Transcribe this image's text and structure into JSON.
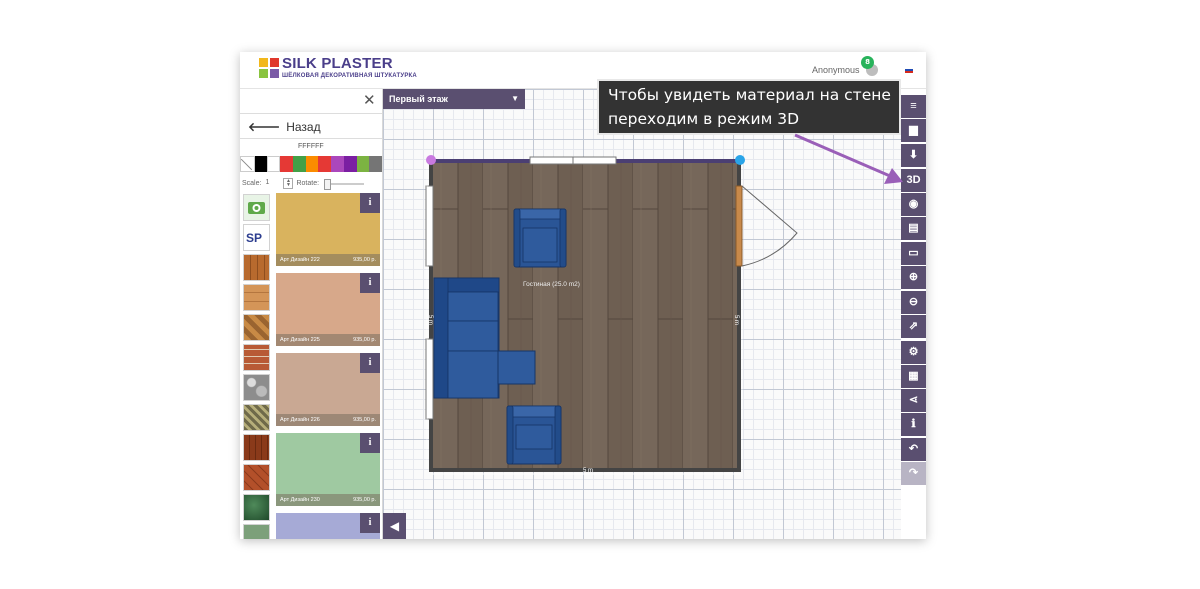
{
  "app": {
    "brand": "SILK PLASTER",
    "tagline": "ШЁЛКОВАЯ ДЕКОРАТИВНАЯ ШТУКАТУРКА",
    "user": {
      "name": "Anonymous",
      "badge": "8"
    },
    "flag_colors": [
      "#ffffff",
      "#1f4bb4",
      "#d52b1e"
    ]
  },
  "sidebar": {
    "back_label": "Назад",
    "color_hex": "FFFFFF",
    "palette": [
      "#000000",
      "#ffffff",
      "#e53935",
      "#43a047",
      "#fb8c00",
      "#e53935",
      "#ab47bc",
      "#7b1fa2",
      "#7cb342",
      "#757575"
    ],
    "scale_label": "Scale:",
    "scale_value": "1",
    "rotate_label": "Rotate:",
    "thumbnails": [
      "camera-upload",
      "sp-logo",
      "wood-planks",
      "wood-light",
      "parquet-diamond",
      "brick",
      "stones",
      "ornament-tile",
      "wood-dark",
      "terracotta",
      "green-marble",
      "partial"
    ],
    "materials": [
      {
        "name": "Арт Дизайн 222",
        "price": "935,00 р.",
        "color": "#d9b35e"
      },
      {
        "name": "Арт Дизайн 225",
        "price": "935,00 р.",
        "color": "#d7a88a"
      },
      {
        "name": "Арт Дизайн 226",
        "price": "935,00 р.",
        "color": "#c9a893"
      },
      {
        "name": "Арт Дизайн 230",
        "price": "935,00 р.",
        "color": "#9fc9a1"
      },
      {
        "name": "",
        "price": "",
        "color": "#a6aad6"
      }
    ]
  },
  "canvas": {
    "floor_selector": "Первый этаж",
    "room_label": "Гостиная (25.0 m2)",
    "dim_bottom": "5 m",
    "dim_left": "5 m",
    "dim_right": "5 m"
  },
  "toolbar": {
    "items": [
      {
        "id": "menu",
        "label": "≡"
      },
      {
        "id": "open",
        "label": "▆"
      },
      {
        "id": "download",
        "label": "⬇"
      },
      {
        "id": "3d",
        "label": "3D"
      },
      {
        "id": "camera",
        "label": "◉"
      },
      {
        "id": "print",
        "label": "▤"
      },
      {
        "id": "ruler",
        "label": "▭"
      },
      {
        "id": "zoom-in",
        "label": "⊕"
      },
      {
        "id": "zoom-out",
        "label": "⊖"
      },
      {
        "id": "export",
        "label": "⇗"
      },
      {
        "id": "settings",
        "label": "⚙"
      },
      {
        "id": "calculator",
        "label": "▦"
      },
      {
        "id": "share",
        "label": "⋖"
      },
      {
        "id": "info",
        "label": "ℹ"
      },
      {
        "id": "undo",
        "label": "↶"
      },
      {
        "id": "redo",
        "label": "↷"
      }
    ]
  },
  "callout": {
    "line1": "Чтобы увидеть материал на стене",
    "line2": "переходим в режим 3D"
  }
}
